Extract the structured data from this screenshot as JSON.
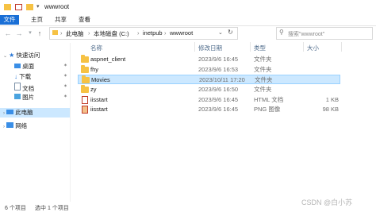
{
  "window": {
    "title": "wwwroot"
  },
  "ribbon": {
    "tabs": [
      "文件",
      "主页",
      "共享",
      "查看"
    ]
  },
  "nav": {
    "breadcrumbs": [
      "此电脑",
      "本地磁盘 (C:)",
      "inetpub",
      "wwwroot"
    ],
    "search_placeholder": "搜索\"wwwroot\""
  },
  "sidebar": {
    "quick_access": "快速访问",
    "items": [
      {
        "label": "桌面",
        "icon": "desktop-icon"
      },
      {
        "label": "下载",
        "icon": "download-icon"
      },
      {
        "label": "文档",
        "icon": "documents-icon"
      },
      {
        "label": "图片",
        "icon": "pictures-icon"
      }
    ],
    "this_pc": "此电脑",
    "network": "网络"
  },
  "list": {
    "columns": {
      "name": "名称",
      "modified": "修改日期",
      "type": "类型",
      "size": "大小"
    },
    "rows": [
      {
        "name": "aspnet_client",
        "modified": "2023/9/6 16:45",
        "type": "文件夹",
        "size": "",
        "kind": "folder"
      },
      {
        "name": "fhy",
        "modified": "2023/9/6 16:53",
        "type": "文件夹",
        "size": "",
        "kind": "folder"
      },
      {
        "name": "Movies",
        "modified": "2023/10/11 17:20",
        "type": "文件夹",
        "size": "",
        "kind": "folder",
        "selected": true
      },
      {
        "name": "zy",
        "modified": "2023/9/6 16:50",
        "type": "文件夹",
        "size": "",
        "kind": "folder"
      },
      {
        "name": "iisstart",
        "modified": "2023/9/6 16:45",
        "type": "HTML 文档",
        "size": "1 KB",
        "kind": "html"
      },
      {
        "name": "iisstart",
        "modified": "2023/9/6 16:45",
        "type": "PNG 图像",
        "size": "98 KB",
        "kind": "png"
      }
    ]
  },
  "status": {
    "count": "6 个项目",
    "selected": "选中 1 个项目"
  },
  "watermark": "CSDN @白小苏"
}
